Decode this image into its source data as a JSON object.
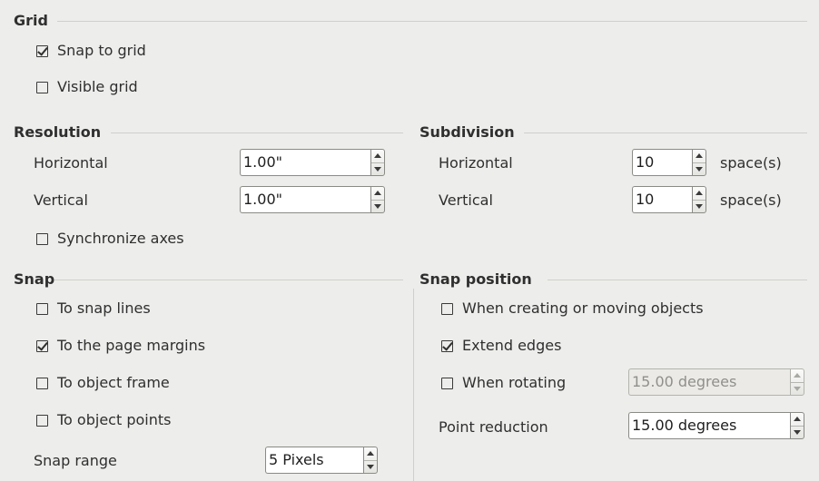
{
  "grid": {
    "title": "Grid",
    "snap_to_grid": {
      "label": "Snap to grid",
      "checked": true
    },
    "visible_grid": {
      "label": "Visible grid",
      "checked": false
    }
  },
  "resolution": {
    "title": "Resolution",
    "horizontal": {
      "label": "Horizontal",
      "value": "1.00\""
    },
    "vertical": {
      "label": "Vertical",
      "value": "1.00\""
    },
    "synchronize": {
      "label": "Synchronize axes",
      "checked": false
    }
  },
  "subdivision": {
    "title": "Subdivision",
    "horizontal": {
      "label": "Horizontal",
      "value": "10",
      "unit": "space(s)"
    },
    "vertical": {
      "label": "Vertical",
      "value": "10",
      "unit": "space(s)"
    }
  },
  "snap": {
    "title": "Snap",
    "snap_lines": {
      "label": "To snap lines",
      "checked": false
    },
    "page_margins": {
      "label": "To the page margins",
      "checked": true
    },
    "object_frame": {
      "label": "To object frame",
      "checked": false
    },
    "object_points": {
      "label": "To object points",
      "checked": false
    },
    "snap_range": {
      "label": "Snap range",
      "value": "5 Pixels"
    }
  },
  "snap_position": {
    "title": "Snap position",
    "creating_moving": {
      "label": "When creating or moving objects",
      "checked": false
    },
    "extend_edges": {
      "label": "Extend edges",
      "checked": true
    },
    "when_rotating": {
      "label": "When rotating",
      "checked": false,
      "value": "15.00 degrees"
    },
    "point_reduction": {
      "label": "Point reduction",
      "value": "15.00 degrees"
    }
  }
}
